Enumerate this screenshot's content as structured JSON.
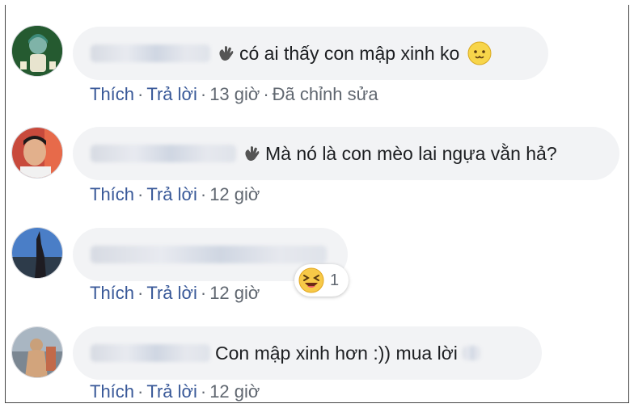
{
  "comments": [
    {
      "text": "có ai thấy con mập xinh ko",
      "actions": {
        "like": "Thích",
        "reply": "Trả lời",
        "time": "13 giờ",
        "edited": "Đã chỉnh sửa"
      },
      "emoji": "smiling-face-emoji"
    },
    {
      "text": "Mà nó là con mèo lai ngựa vằn hả?",
      "actions": {
        "like": "Thích",
        "reply": "Trả lời",
        "time": "12 giờ"
      }
    },
    {
      "text": "",
      "actions": {
        "like": "Thích",
        "reply": "Trả lời",
        "time": "12 giờ"
      },
      "reaction": {
        "icon": "laughing-emoji",
        "count": "1"
      }
    },
    {
      "text": "Con mập xinh hơn :)) mua lời",
      "actions": {
        "like": "Thích",
        "reply": "Trả lời",
        "time": "12 giờ"
      }
    }
  ],
  "colors": {
    "bubble": "#f2f3f5",
    "link": "#385898",
    "meta": "#606770",
    "text": "#1c1e21"
  }
}
